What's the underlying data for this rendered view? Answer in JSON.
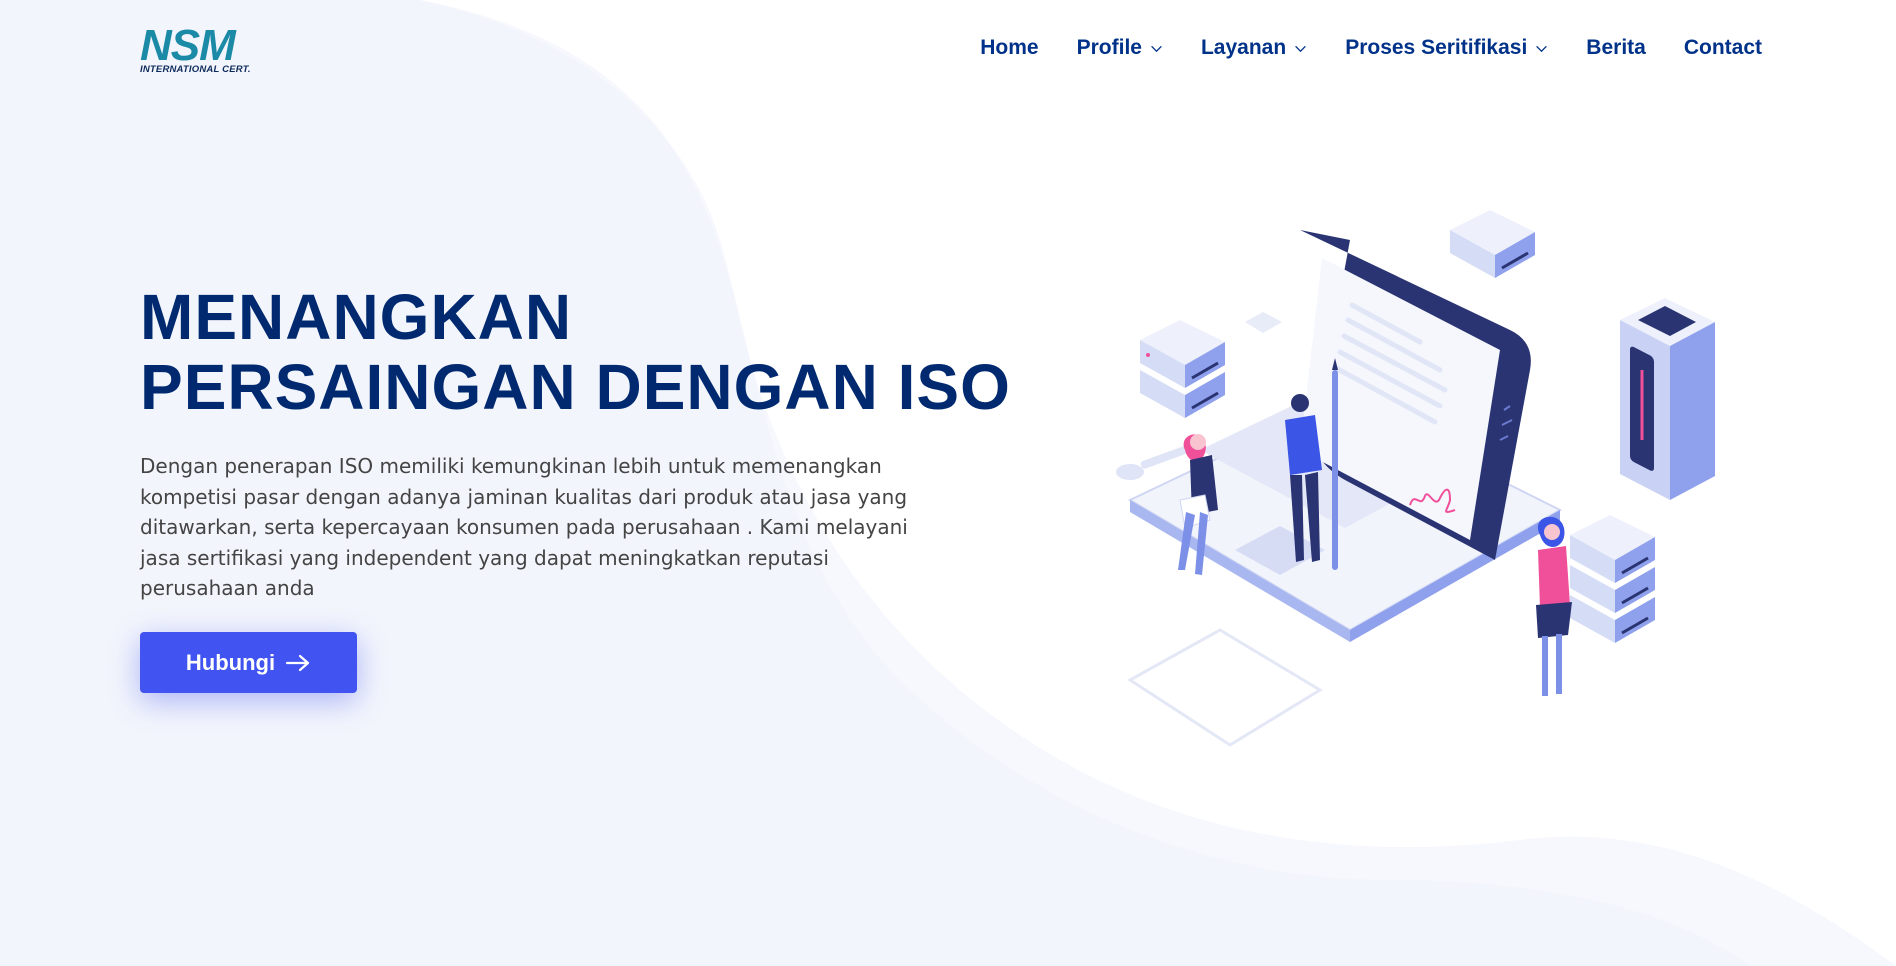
{
  "brand": {
    "logo_text": "NSM",
    "logo_subtitle": "INTERNATIONAL CERT.",
    "logo_color": "#1b8aa6"
  },
  "nav": {
    "items": [
      {
        "label": "Home",
        "has_dropdown": false
      },
      {
        "label": "Profile",
        "has_dropdown": true
      },
      {
        "label": "Layanan",
        "has_dropdown": true
      },
      {
        "label": "Proses Seritifikasi",
        "has_dropdown": true
      },
      {
        "label": "Berita",
        "has_dropdown": false
      },
      {
        "label": "Contact",
        "has_dropdown": false
      }
    ]
  },
  "hero": {
    "title_line1": "MENANGKAN",
    "title_line2": "PERSAINGAN DENGAN ISO",
    "description": "Dengan penerapan ISO memiliki kemungkinan lebih untuk memenangkan kompetisi pasar dengan adanya jaminan kualitas dari produk atau jasa yang ditawarkan, serta kepercayaan konsumen pada perusahaan . Kami melayani jasa sertifikasi yang independent yang dapat meningkatkan reputasi perusahaan anda",
    "cta_label": "Hubungi",
    "cta_icon": "arrow-right-icon"
  },
  "colors": {
    "primary": "#4154f1",
    "heading": "#012970",
    "nav_text": "#013289",
    "body_text": "#444444",
    "background_wave": "#f3f5fc"
  }
}
